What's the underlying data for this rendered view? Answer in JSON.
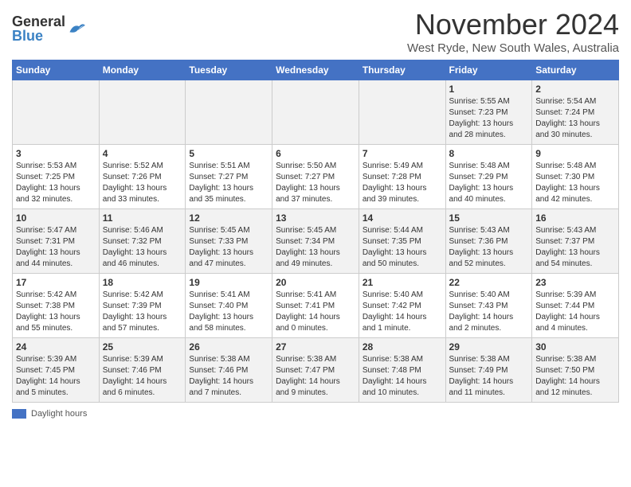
{
  "logo": {
    "text_general": "General",
    "text_blue": "Blue"
  },
  "title": "November 2024",
  "subtitle": "West Ryde, New South Wales, Australia",
  "days_of_week": [
    "Sunday",
    "Monday",
    "Tuesday",
    "Wednesday",
    "Thursday",
    "Friday",
    "Saturday"
  ],
  "weeks": [
    [
      {
        "day": "",
        "sunrise": "",
        "sunset": "",
        "daylight": ""
      },
      {
        "day": "",
        "sunrise": "",
        "sunset": "",
        "daylight": ""
      },
      {
        "day": "",
        "sunrise": "",
        "sunset": "",
        "daylight": ""
      },
      {
        "day": "",
        "sunrise": "",
        "sunset": "",
        "daylight": ""
      },
      {
        "day": "",
        "sunrise": "",
        "sunset": "",
        "daylight": ""
      },
      {
        "day": "1",
        "sunrise": "5:55 AM",
        "sunset": "7:23 PM",
        "daylight": "13 hours and 28 minutes."
      },
      {
        "day": "2",
        "sunrise": "5:54 AM",
        "sunset": "7:24 PM",
        "daylight": "13 hours and 30 minutes."
      }
    ],
    [
      {
        "day": "3",
        "sunrise": "5:53 AM",
        "sunset": "7:25 PM",
        "daylight": "13 hours and 32 minutes."
      },
      {
        "day": "4",
        "sunrise": "5:52 AM",
        "sunset": "7:26 PM",
        "daylight": "13 hours and 33 minutes."
      },
      {
        "day": "5",
        "sunrise": "5:51 AM",
        "sunset": "7:27 PM",
        "daylight": "13 hours and 35 minutes."
      },
      {
        "day": "6",
        "sunrise": "5:50 AM",
        "sunset": "7:27 PM",
        "daylight": "13 hours and 37 minutes."
      },
      {
        "day": "7",
        "sunrise": "5:49 AM",
        "sunset": "7:28 PM",
        "daylight": "13 hours and 39 minutes."
      },
      {
        "day": "8",
        "sunrise": "5:48 AM",
        "sunset": "7:29 PM",
        "daylight": "13 hours and 40 minutes."
      },
      {
        "day": "9",
        "sunrise": "5:48 AM",
        "sunset": "7:30 PM",
        "daylight": "13 hours and 42 minutes."
      }
    ],
    [
      {
        "day": "10",
        "sunrise": "5:47 AM",
        "sunset": "7:31 PM",
        "daylight": "13 hours and 44 minutes."
      },
      {
        "day": "11",
        "sunrise": "5:46 AM",
        "sunset": "7:32 PM",
        "daylight": "13 hours and 46 minutes."
      },
      {
        "day": "12",
        "sunrise": "5:45 AM",
        "sunset": "7:33 PM",
        "daylight": "13 hours and 47 minutes."
      },
      {
        "day": "13",
        "sunrise": "5:45 AM",
        "sunset": "7:34 PM",
        "daylight": "13 hours and 49 minutes."
      },
      {
        "day": "14",
        "sunrise": "5:44 AM",
        "sunset": "7:35 PM",
        "daylight": "13 hours and 50 minutes."
      },
      {
        "day": "15",
        "sunrise": "5:43 AM",
        "sunset": "7:36 PM",
        "daylight": "13 hours and 52 minutes."
      },
      {
        "day": "16",
        "sunrise": "5:43 AM",
        "sunset": "7:37 PM",
        "daylight": "13 hours and 54 minutes."
      }
    ],
    [
      {
        "day": "17",
        "sunrise": "5:42 AM",
        "sunset": "7:38 PM",
        "daylight": "13 hours and 55 minutes."
      },
      {
        "day": "18",
        "sunrise": "5:42 AM",
        "sunset": "7:39 PM",
        "daylight": "13 hours and 57 minutes."
      },
      {
        "day": "19",
        "sunrise": "5:41 AM",
        "sunset": "7:40 PM",
        "daylight": "13 hours and 58 minutes."
      },
      {
        "day": "20",
        "sunrise": "5:41 AM",
        "sunset": "7:41 PM",
        "daylight": "14 hours and 0 minutes."
      },
      {
        "day": "21",
        "sunrise": "5:40 AM",
        "sunset": "7:42 PM",
        "daylight": "14 hours and 1 minute."
      },
      {
        "day": "22",
        "sunrise": "5:40 AM",
        "sunset": "7:43 PM",
        "daylight": "14 hours and 2 minutes."
      },
      {
        "day": "23",
        "sunrise": "5:39 AM",
        "sunset": "7:44 PM",
        "daylight": "14 hours and 4 minutes."
      }
    ],
    [
      {
        "day": "24",
        "sunrise": "5:39 AM",
        "sunset": "7:45 PM",
        "daylight": "14 hours and 5 minutes."
      },
      {
        "day": "25",
        "sunrise": "5:39 AM",
        "sunset": "7:46 PM",
        "daylight": "14 hours and 6 minutes."
      },
      {
        "day": "26",
        "sunrise": "5:38 AM",
        "sunset": "7:46 PM",
        "daylight": "14 hours and 7 minutes."
      },
      {
        "day": "27",
        "sunrise": "5:38 AM",
        "sunset": "7:47 PM",
        "daylight": "14 hours and 9 minutes."
      },
      {
        "day": "28",
        "sunrise": "5:38 AM",
        "sunset": "7:48 PM",
        "daylight": "14 hours and 10 minutes."
      },
      {
        "day": "29",
        "sunrise": "5:38 AM",
        "sunset": "7:49 PM",
        "daylight": "14 hours and 11 minutes."
      },
      {
        "day": "30",
        "sunrise": "5:38 AM",
        "sunset": "7:50 PM",
        "daylight": "14 hours and 12 minutes."
      }
    ]
  ],
  "legend": {
    "daylight_label": "Daylight hours"
  }
}
